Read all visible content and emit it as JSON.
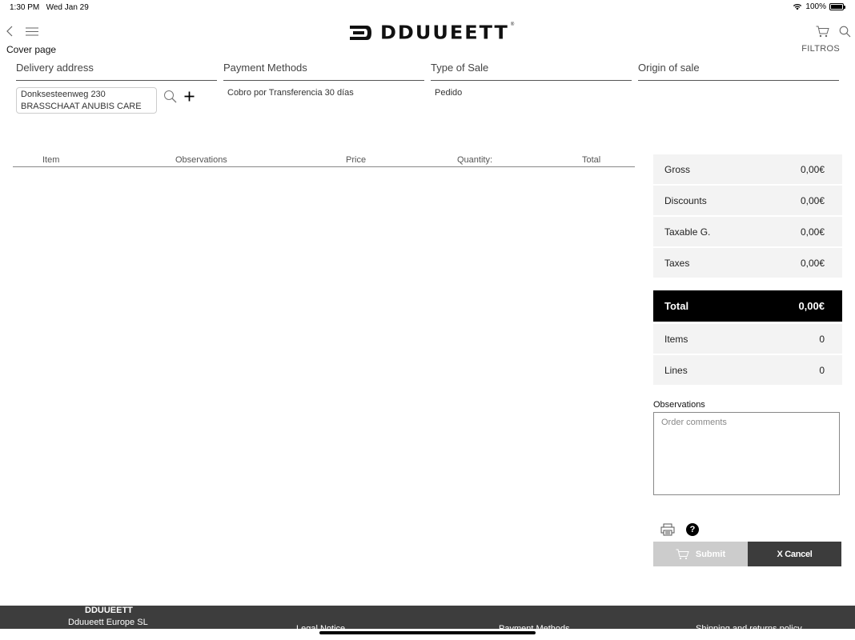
{
  "status_bar": {
    "time": "1:30 PM",
    "date": "Wed Jan 29",
    "battery": "100%"
  },
  "header": {
    "logo_text": "DDUUEETT",
    "logo_tm": "®",
    "back_icon": "chevron-left-icon",
    "menu_icon": "hamburger-icon",
    "cart_icon": "cart-icon",
    "search_icon": "search-icon"
  },
  "page": {
    "title": "Cover page",
    "filters_label": "FILTROS"
  },
  "columns": {
    "delivery": {
      "label": "Delivery address",
      "line1": "Donksesteenweg 230",
      "line2": "BRASSCHAAT ANUBIS CARE"
    },
    "payment": {
      "label": "Payment Methods",
      "value": "Cobro por Transferencia 30 días"
    },
    "sale_type": {
      "label": "Type of Sale",
      "value": "Pedido"
    },
    "origin": {
      "label": "Origin of sale",
      "value": ""
    }
  },
  "table": {
    "headers": [
      "Item",
      "Observations",
      "Price",
      "Quantity:",
      "Total"
    ],
    "rows": []
  },
  "summary": {
    "gross": {
      "label": "Gross",
      "value": "0,00€"
    },
    "discounts": {
      "label": "Discounts",
      "value": "0,00€"
    },
    "taxable": {
      "label": "Taxable G.",
      "value": "0,00€"
    },
    "taxes": {
      "label": "Taxes",
      "value": "0,00€"
    },
    "total": {
      "label": "Total",
      "value": "0,00€"
    },
    "items": {
      "label": "Items",
      "value": "0"
    },
    "lines": {
      "label": "Lines",
      "value": "0"
    }
  },
  "observations": {
    "label": "Observations",
    "placeholder": "Order comments",
    "value": ""
  },
  "actions": {
    "help": "?",
    "submit_label": "Submit",
    "cancel_label": "X Cancel"
  },
  "footer": {
    "brand": "DDUUEETT",
    "company": "Dduueett Europe SL",
    "links": [
      "Legal Notice",
      "Payment Methods",
      "Shipping and returns policy"
    ]
  },
  "colors": {
    "accent": "#000000",
    "cancel_bg": "#3c3c3c",
    "submit_disabled_bg": "#cccccc",
    "footer_bg": "#3d3d3d"
  }
}
